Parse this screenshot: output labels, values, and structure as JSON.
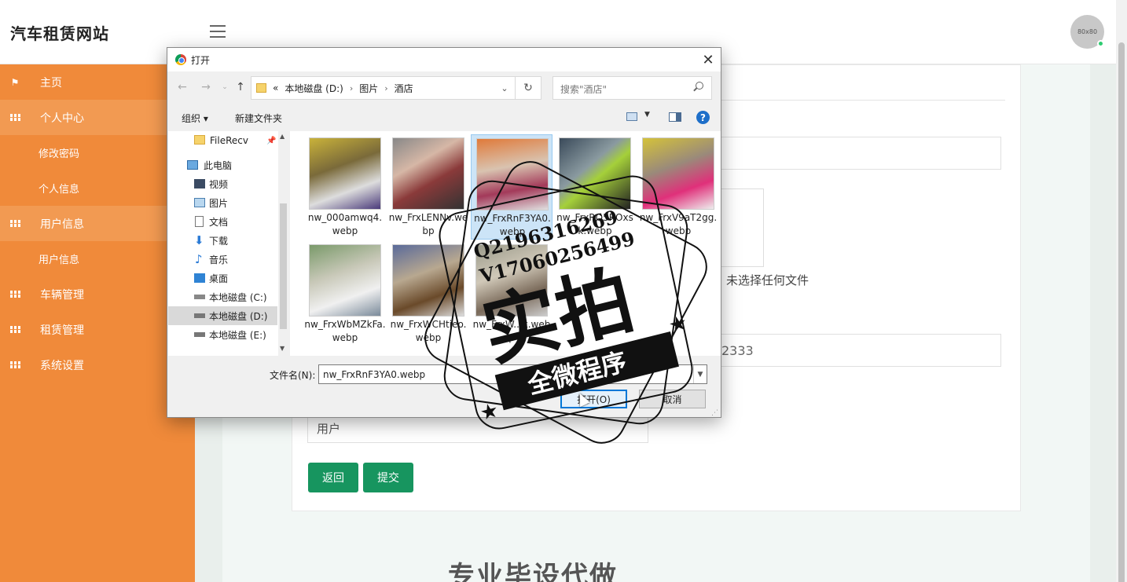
{
  "header": {
    "site_title": "汽车租赁网站",
    "avatar_text": "80x80"
  },
  "sidebar": {
    "items": [
      {
        "label": "主页",
        "icon": "flag-icon",
        "type": "top"
      },
      {
        "label": "个人中心",
        "icon": "grid-icon",
        "type": "top"
      },
      {
        "label": "修改密码",
        "type": "sub"
      },
      {
        "label": "个人信息",
        "type": "sub"
      },
      {
        "label": "用户信息",
        "icon": "grid-icon",
        "type": "top"
      },
      {
        "label": "用户信息",
        "type": "sub"
      },
      {
        "label": "车辆管理",
        "icon": "grid-icon",
        "type": "top"
      },
      {
        "label": "租赁管理",
        "icon": "grid-icon",
        "type": "top"
      },
      {
        "label": "系统设置",
        "icon": "grid-icon",
        "type": "top"
      }
    ]
  },
  "form": {
    "no_file_text": "未选择任何文件",
    "phone_value": "2333",
    "role_value": "用户",
    "back_button": "返回",
    "submit_button": "提交"
  },
  "footer": {
    "overlay_text": "专业毕设代做"
  },
  "dialog": {
    "title": "打开",
    "breadcrumb": [
      "本地磁盘 (D:)",
      "图片",
      "酒店"
    ],
    "breadcrumb_prefix": "«",
    "search_placeholder": "搜索\"酒店\"",
    "toolbar": {
      "organize": "组织 ▾",
      "new_folder": "新建文件夹",
      "help": "?"
    },
    "tree": [
      {
        "label": "FileRecv",
        "icon": "folder-icon"
      },
      {
        "label": "此电脑",
        "icon": "computer-icon"
      },
      {
        "label": "视频",
        "icon": "video-icon"
      },
      {
        "label": "图片",
        "icon": "pictures-icon"
      },
      {
        "label": "文档",
        "icon": "document-icon"
      },
      {
        "label": "下载",
        "icon": "download-icon"
      },
      {
        "label": "音乐",
        "icon": "music-icon"
      },
      {
        "label": "桌面",
        "icon": "desktop-icon"
      },
      {
        "label": "本地磁盘 (C:)",
        "icon": "drive-icon"
      },
      {
        "label": "本地磁盘 (D:)",
        "icon": "drive-icon",
        "selected": true
      },
      {
        "label": "本地磁盘 (E:)",
        "icon": "drive-icon"
      }
    ],
    "files": [
      {
        "name": "nw_000amwq4.webp"
      },
      {
        "name": "nw_FrxLENNv.webp"
      },
      {
        "name": "nw_FrxRnF3YA0.webp",
        "selected": true
      },
      {
        "name": "nw_FrxRO5ROxsk.webp"
      },
      {
        "name": "nw_FrxV9aT2gg.webp"
      },
      {
        "name": "nw_FrxWbMZkFa.webp"
      },
      {
        "name": "nw_FrxWCHtieo.webp"
      },
      {
        "name": "nw_FrxW...k.webp"
      }
    ],
    "filename_label": "文件名(N):",
    "filename_value": "nw_FrxRnF3YA0.webp",
    "open_button": "打开(O)",
    "cancel_button": "取消"
  },
  "watermark": {
    "line1": "Q2196316269",
    "line2": "V17060256499",
    "main": "实拍",
    "banner": "全微程序"
  },
  "colors": {
    "sidebar": "#f08a3a",
    "sidebar_active": "#f29a52",
    "button": "#17955f",
    "dialog_accent": "#0078d7"
  }
}
